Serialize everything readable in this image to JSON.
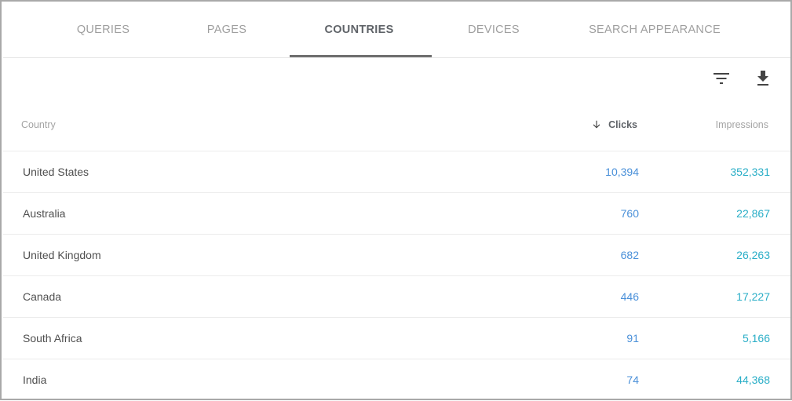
{
  "tabs": [
    {
      "label": "QUERIES",
      "active": false
    },
    {
      "label": "PAGES",
      "active": false
    },
    {
      "label": "COUNTRIES",
      "active": true
    },
    {
      "label": "DEVICES",
      "active": false
    },
    {
      "label": "SEARCH APPEARANCE",
      "active": false
    }
  ],
  "toolbar": {
    "filter_icon": "filter-icon",
    "download_icon": "download-icon"
  },
  "table": {
    "columns": {
      "country": "Country",
      "clicks": "Clicks",
      "impressions": "Impressions"
    },
    "sort": {
      "column": "clicks",
      "direction": "descending",
      "icon": "arrow-down-icon"
    },
    "rows": [
      {
        "country": "United States",
        "clicks": "10,394",
        "impressions": "352,331"
      },
      {
        "country": "Australia",
        "clicks": "760",
        "impressions": "22,867"
      },
      {
        "country": "United Kingdom",
        "clicks": "682",
        "impressions": "26,263"
      },
      {
        "country": "Canada",
        "clicks": "446",
        "impressions": "17,227"
      },
      {
        "country": "South Africa",
        "clicks": "91",
        "impressions": "5,166"
      },
      {
        "country": "India",
        "clicks": "74",
        "impressions": "44,368"
      }
    ]
  },
  "colors": {
    "clicks": "#4a90d9",
    "impressions": "#2aaec7",
    "active_tab_indicator": "#6f6f6f"
  }
}
